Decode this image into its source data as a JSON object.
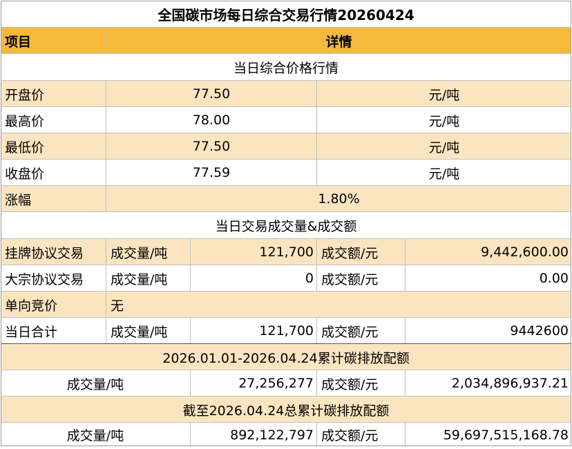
{
  "title": "全国碳市场每日综合交易行情20260424",
  "header": {
    "item": "项目",
    "detail": "详情"
  },
  "price_section": {
    "heading": "当日综合价格行情",
    "rows": [
      {
        "label": "开盘价",
        "value": "77.50",
        "unit": "元/吨"
      },
      {
        "label": "最高价",
        "value": "78.00",
        "unit": "元/吨"
      },
      {
        "label": "最低价",
        "value": "77.50",
        "unit": "元/吨"
      },
      {
        "label": "收盘价",
        "value": "77.59",
        "unit": "元/吨"
      }
    ],
    "change": {
      "label": "涨幅",
      "value": "1.80%"
    }
  },
  "volume_section": {
    "heading": "当日交易成交量&成交额",
    "rows": [
      {
        "label": "挂牌协议交易",
        "vol_label": "成交量/吨",
        "vol": "121,700",
        "amt_label": "成交额/元",
        "amt": "9,442,600.00"
      },
      {
        "label": "大宗协议交易",
        "vol_label": "成交量/吨",
        "vol": "0",
        "amt_label": "成交额/元",
        "amt": "0.00"
      }
    ],
    "single": {
      "label": "单向竞价",
      "value": "无"
    },
    "total": {
      "label": "当日合计",
      "vol_label": "成交量/吨",
      "vol": "121,700",
      "amt_label": "成交额/元",
      "amt": "9442600"
    }
  },
  "ytd_section": {
    "heading": "2026.01.01-2026.04.24累计碳排放配额",
    "vol_label": "成交量/吨",
    "vol": "27,256,277",
    "amt_label": "成交额/元",
    "amt": "2,034,896,937.21"
  },
  "cumulative_section": {
    "heading": "截至2026.04.24总累计碳排放配额",
    "vol_label": "成交量/吨",
    "vol": "892,122,797",
    "amt_label": "成交额/元",
    "amt": "59,697,515,168.78"
  },
  "colors": {
    "header_orange": "#f6b93b",
    "row_tint": "#fbe5c1",
    "border": "#bfbfbf"
  }
}
